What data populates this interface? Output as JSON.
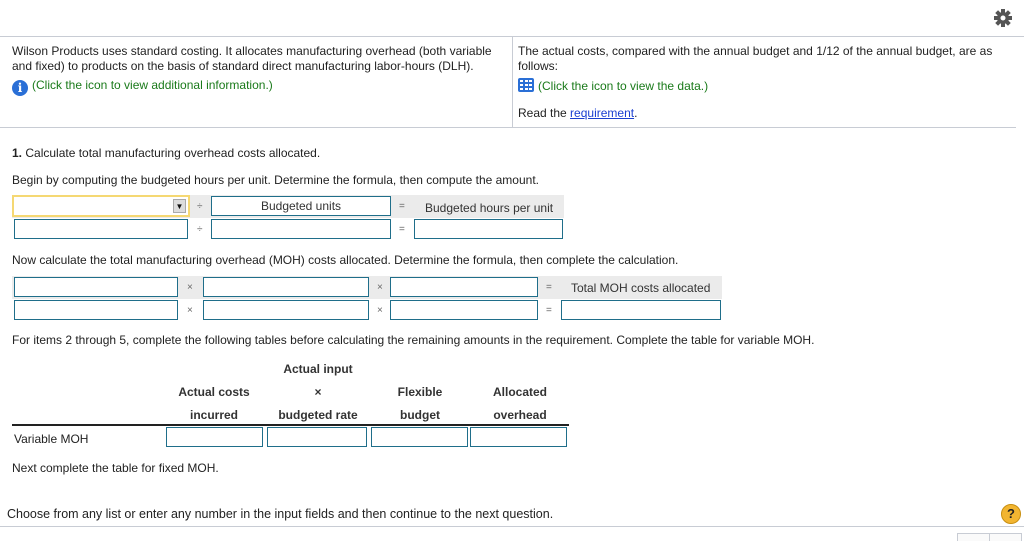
{
  "header": {
    "settings_icon": "gear-icon"
  },
  "intro": {
    "left_text": "Wilson Products uses standard costing. It allocates manufacturing overhead (both variable and fixed) to products on the basis of standard direct manufacturing labor-hours (DLH).",
    "left_link": "(Click the icon to view additional information.)",
    "left_icon": "info-icon",
    "right_text": "The actual costs, compared with the annual budget and 1/12 of the annual budget, are as follows:",
    "right_link": "(Click the icon to view the data.)",
    "right_icon": "data-table-icon",
    "read_prefix": "Read the ",
    "read_link": "requirement",
    "read_suffix": "."
  },
  "question": {
    "step1_number": "1.",
    "step1_title": " Calculate total manufacturing overhead costs allocated.",
    "begin_text": "Begin by computing the budgeted hours per unit. Determine the formula, then compute the amount.",
    "formula1": {
      "dropdown_value": "",
      "operator1": "÷",
      "label2": "Budgeted units",
      "equals": "=",
      "result_label": "Budgeted hours per unit"
    },
    "now_text": "Now calculate the total manufacturing overhead (MOH) costs allocated. Determine the formula, then complete the calculation.",
    "formula2": {
      "operator": "×",
      "equals": "=",
      "result_label": "Total MOH costs allocated"
    },
    "items_text": "For items 2 through 5, complete the following tables before calculating the remaining amounts in the requirement. Complete the table for variable MOH.",
    "table": {
      "group_header": "Actual input",
      "columns": [
        {
          "line1": "Actual costs",
          "line2": "incurred"
        },
        {
          "line1": "×",
          "line2": "budgeted rate"
        },
        {
          "line1": "Flexible",
          "line2": "budget"
        },
        {
          "line1": "Allocated",
          "line2": "overhead"
        }
      ],
      "rows": [
        {
          "label": "Variable MOH",
          "values": [
            "",
            "",
            "",
            ""
          ]
        }
      ]
    },
    "next_text": "Next complete the table for fixed MOH."
  },
  "footer": {
    "instruction": "Choose from any list or enter any number in the input fields and then continue to the next question.",
    "help_label": "?"
  }
}
